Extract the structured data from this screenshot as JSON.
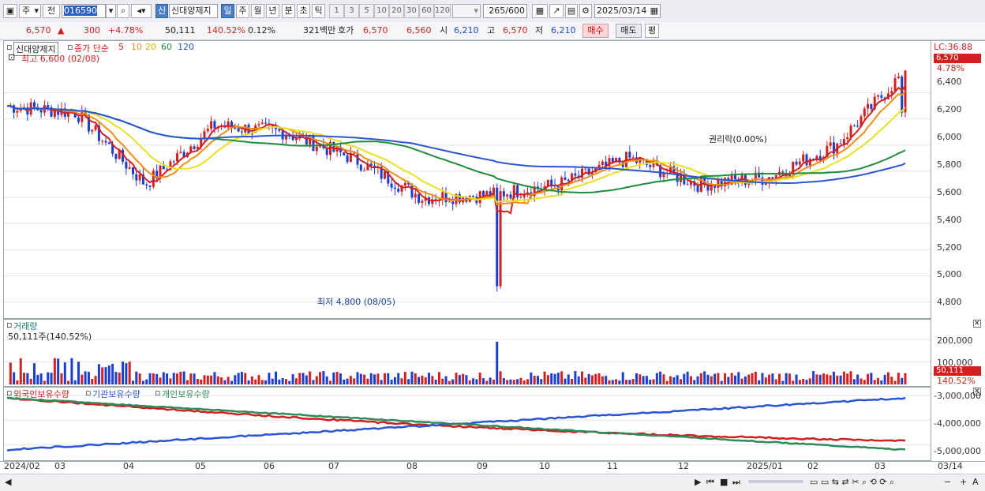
{
  "toolbar": {
    "market_type": "주",
    "prev_label": "전",
    "code": "016590",
    "stock_name": "신대양제지",
    "sin_tag": "신",
    "period_buttons": [
      "일",
      "주",
      "월",
      "년",
      "분",
      "초",
      "틱"
    ],
    "interval_buttons": [
      "1",
      "3",
      "5",
      "10",
      "20",
      "30",
      "60",
      "120"
    ],
    "count": "265",
    "count_total": "/600",
    "date": "2025/03/14"
  },
  "quote": {
    "price": "6,570",
    "change_arrow": "▲",
    "change": "300",
    "change_pct": "+4.78%",
    "volume": "50,111",
    "volume_ratio": "140.52%",
    "turnover": "0.12%",
    "amount": "321백만",
    "ask_label": "호가",
    "ask": "6,570",
    "bid": "6,560",
    "open_label": "시",
    "open": "6,210",
    "high_label": "고",
    "high": "6,570",
    "low_label": "저",
    "low": "6,210",
    "buy_button": "매수",
    "sell_button": "매도",
    "eval_button": "평"
  },
  "price_panel": {
    "legend_name": "신대양제지",
    "legend_ma_title": "종가 단순",
    "ma_periods": [
      "5",
      "10",
      "20",
      "60",
      "120"
    ],
    "ma_colors": [
      "#d21f1f",
      "#f08c1a",
      "#e8e020",
      "#1e8c3c",
      "#2a55d0"
    ],
    "high_note": "최고 6,600 (02/08)",
    "low_note": "최저 4,800 (08/05)",
    "ex_note": "권리락(0.00%)",
    "lc_label": "LC:36.88",
    "last_price_tag": "6,570",
    "last_pct_tag": "4.78%",
    "y_ticks": [
      "6,400",
      "6,200",
      "6,000",
      "5,800",
      "5,600",
      "5,400",
      "5,200",
      "5,000",
      "4,800"
    ]
  },
  "volume_panel": {
    "title": "거래량",
    "value_note": "50,111주(140.52%)",
    "y_ticks": [
      "200,000",
      "100,000"
    ],
    "last_tag": "50,111",
    "last_pct": "140.52%"
  },
  "holding_panel": {
    "series": [
      {
        "name": "외국인보유수량",
        "color": "#d21f1f"
      },
      {
        "name": "기관보유수량",
        "color": "#2a55d0"
      },
      {
        "name": "개인보유수량",
        "color": "#2e8b57"
      }
    ],
    "y_ticks": [
      "-3,000,000",
      "-4,000,000",
      "-5,000,000"
    ]
  },
  "x_axis": {
    "labels": [
      "2024/02",
      "03",
      "04",
      "05",
      "06",
      "07",
      "08",
      "09",
      "10",
      "11",
      "12",
      "2025/01",
      "02",
      "03"
    ],
    "current": "03/14"
  },
  "chart_data": {
    "type": "candlestick",
    "title": "신대양제지",
    "y_range": [
      4800,
      6570
    ],
    "series_summary": [
      {
        "date": "2024/02",
        "close": 6300
      },
      {
        "date": "2024/03",
        "close": 6250
      },
      {
        "date": "2024/04",
        "close": 5700
      },
      {
        "date": "2024/05",
        "close": 6150
      },
      {
        "date": "2024/06",
        "close": 6100
      },
      {
        "date": "2024/07",
        "close": 5900
      },
      {
        "date": "2024/08",
        "close": 5600
      },
      {
        "date": "2024/09",
        "close": 5620
      },
      {
        "date": "2024/10",
        "close": 5700
      },
      {
        "date": "2024/11",
        "close": 5900
      },
      {
        "date": "2024/12",
        "close": 5700
      },
      {
        "date": "2025/01",
        "close": 5750
      },
      {
        "date": "2025/02",
        "close": 6000
      },
      {
        "date": "2025/03",
        "close": 6570
      }
    ],
    "high": {
      "value": 6600,
      "date": "02/08"
    },
    "low": {
      "value": 4800,
      "date": "08/05"
    },
    "volume_last": 50111
  }
}
